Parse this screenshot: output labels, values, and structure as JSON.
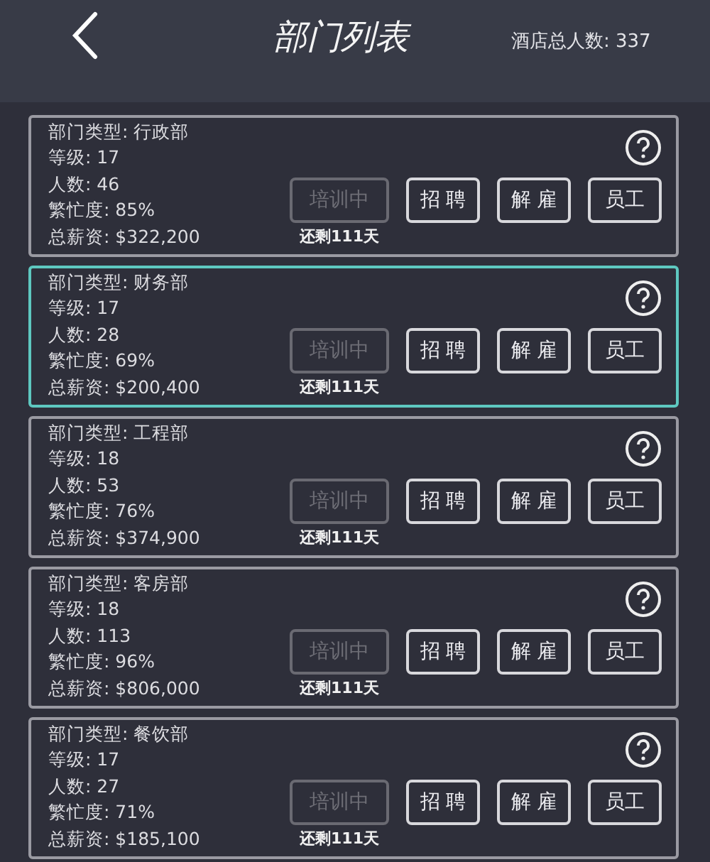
{
  "header": {
    "title": "部门列表",
    "total": "酒店总人数: 337"
  },
  "departments": [
    {
      "selected": false,
      "lines": [
        "部门类型: 行政部",
        "等级: 17",
        "人数: 46",
        "繁忙度: 85%",
        "总薪资: $322,200"
      ],
      "training": {
        "label": "培训中",
        "disabled": true,
        "note": "还剩111天"
      },
      "actions": [
        "招 聘",
        "解 雇",
        "员工"
      ]
    },
    {
      "selected": true,
      "lines": [
        "部门类型: 财务部",
        "等级: 17",
        "人数: 28",
        "繁忙度: 69%",
        "总薪资: $200,400"
      ],
      "training": {
        "label": "培训中",
        "disabled": true,
        "note": "还剩111天"
      },
      "actions": [
        "招 聘",
        "解 雇",
        "员工"
      ]
    },
    {
      "selected": false,
      "lines": [
        "部门类型: 工程部",
        "等级: 18",
        "人数: 53",
        "繁忙度: 76%",
        "总薪资: $374,900"
      ],
      "training": {
        "label": "培训中",
        "disabled": true,
        "note": "还剩111天"
      },
      "actions": [
        "招 聘",
        "解 雇",
        "员工"
      ]
    },
    {
      "selected": false,
      "lines": [
        "部门类型: 客房部",
        "等级: 18",
        "人数: 113",
        "繁忙度: 96%",
        "总薪资: $806,000"
      ],
      "training": {
        "label": "培训中",
        "disabled": true,
        "note": "还剩111天"
      },
      "actions": [
        "招 聘",
        "解 雇",
        "员工"
      ]
    },
    {
      "selected": false,
      "lines": [
        "部门类型: 餐饮部",
        "等级: 17",
        "人数: 27",
        "繁忙度: 71%",
        "总薪资: $185,100"
      ],
      "training": {
        "label": "培训中",
        "disabled": true,
        "note": "还剩111天"
      },
      "actions": [
        "招 聘",
        "解 雇",
        "员工"
      ]
    }
  ]
}
